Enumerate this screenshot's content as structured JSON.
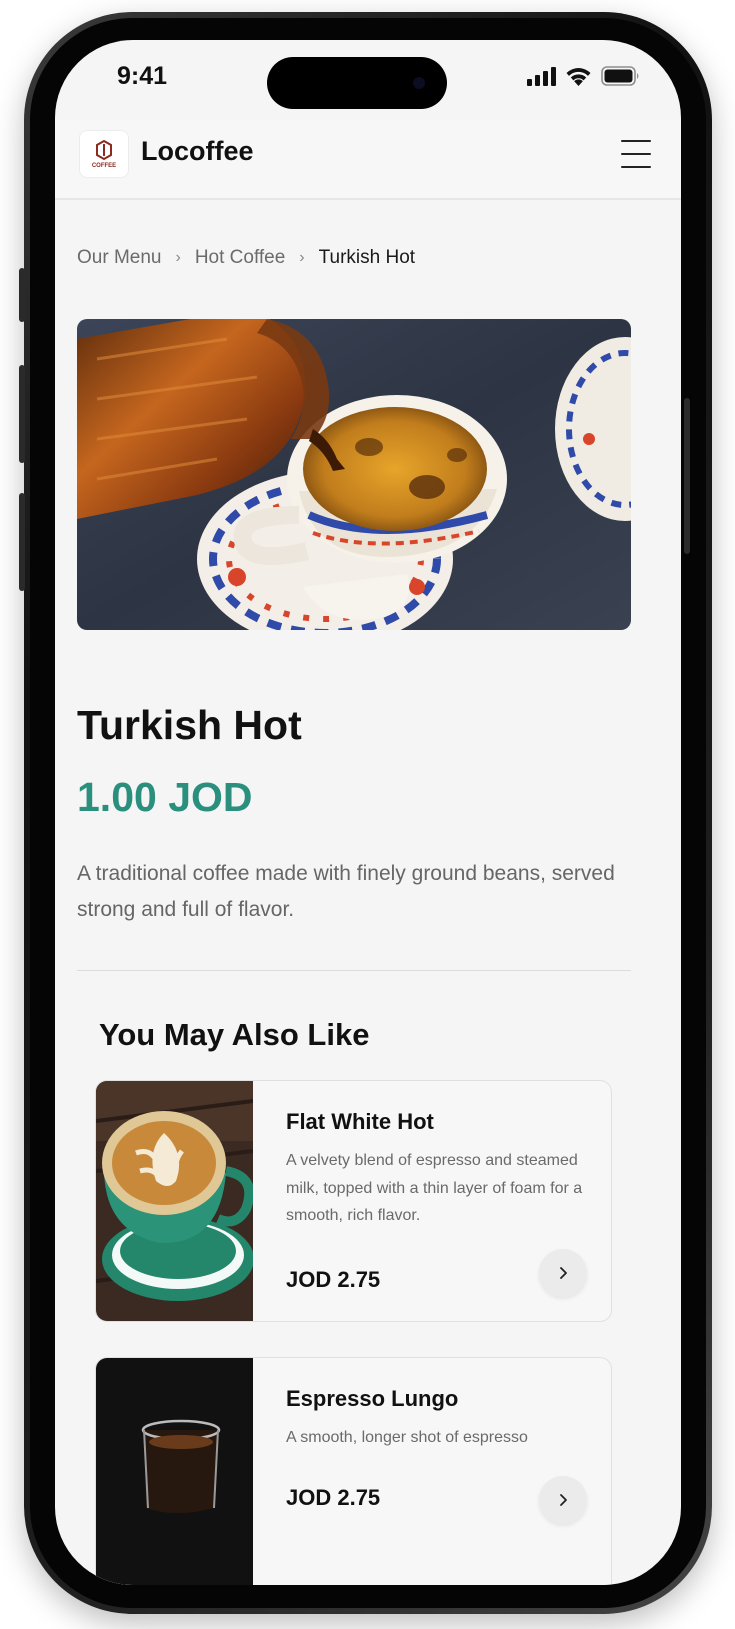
{
  "status_bar": {
    "time": "9:41"
  },
  "header": {
    "logo_caption": "COFFEE",
    "brand": "Locoffee",
    "menu_icon": "hamburger-menu-icon"
  },
  "breadcrumb": {
    "items": [
      "Our Menu",
      "Hot Coffee",
      "Turkish Hot"
    ]
  },
  "product": {
    "name": "Turkish Hot",
    "price": "1.00 JOD",
    "description": "A traditional coffee made with finely ground beans, served strong and full of flavor."
  },
  "recommendations": {
    "title": "You May Also Like",
    "items": [
      {
        "name": "Flat White Hot",
        "description": "A velvety blend of espresso and steamed milk, topped with a thin layer of foam for a smooth, rich flavor.",
        "price": "JOD 2.75"
      },
      {
        "name": "Espresso Lungo",
        "description": "A smooth, longer shot of espresso",
        "price": "JOD 2.75"
      }
    ]
  },
  "colors": {
    "accent_price": "#2a8f7c",
    "text_primary": "#111111",
    "text_secondary": "#666666",
    "screen_bg": "#f5f5f6"
  }
}
